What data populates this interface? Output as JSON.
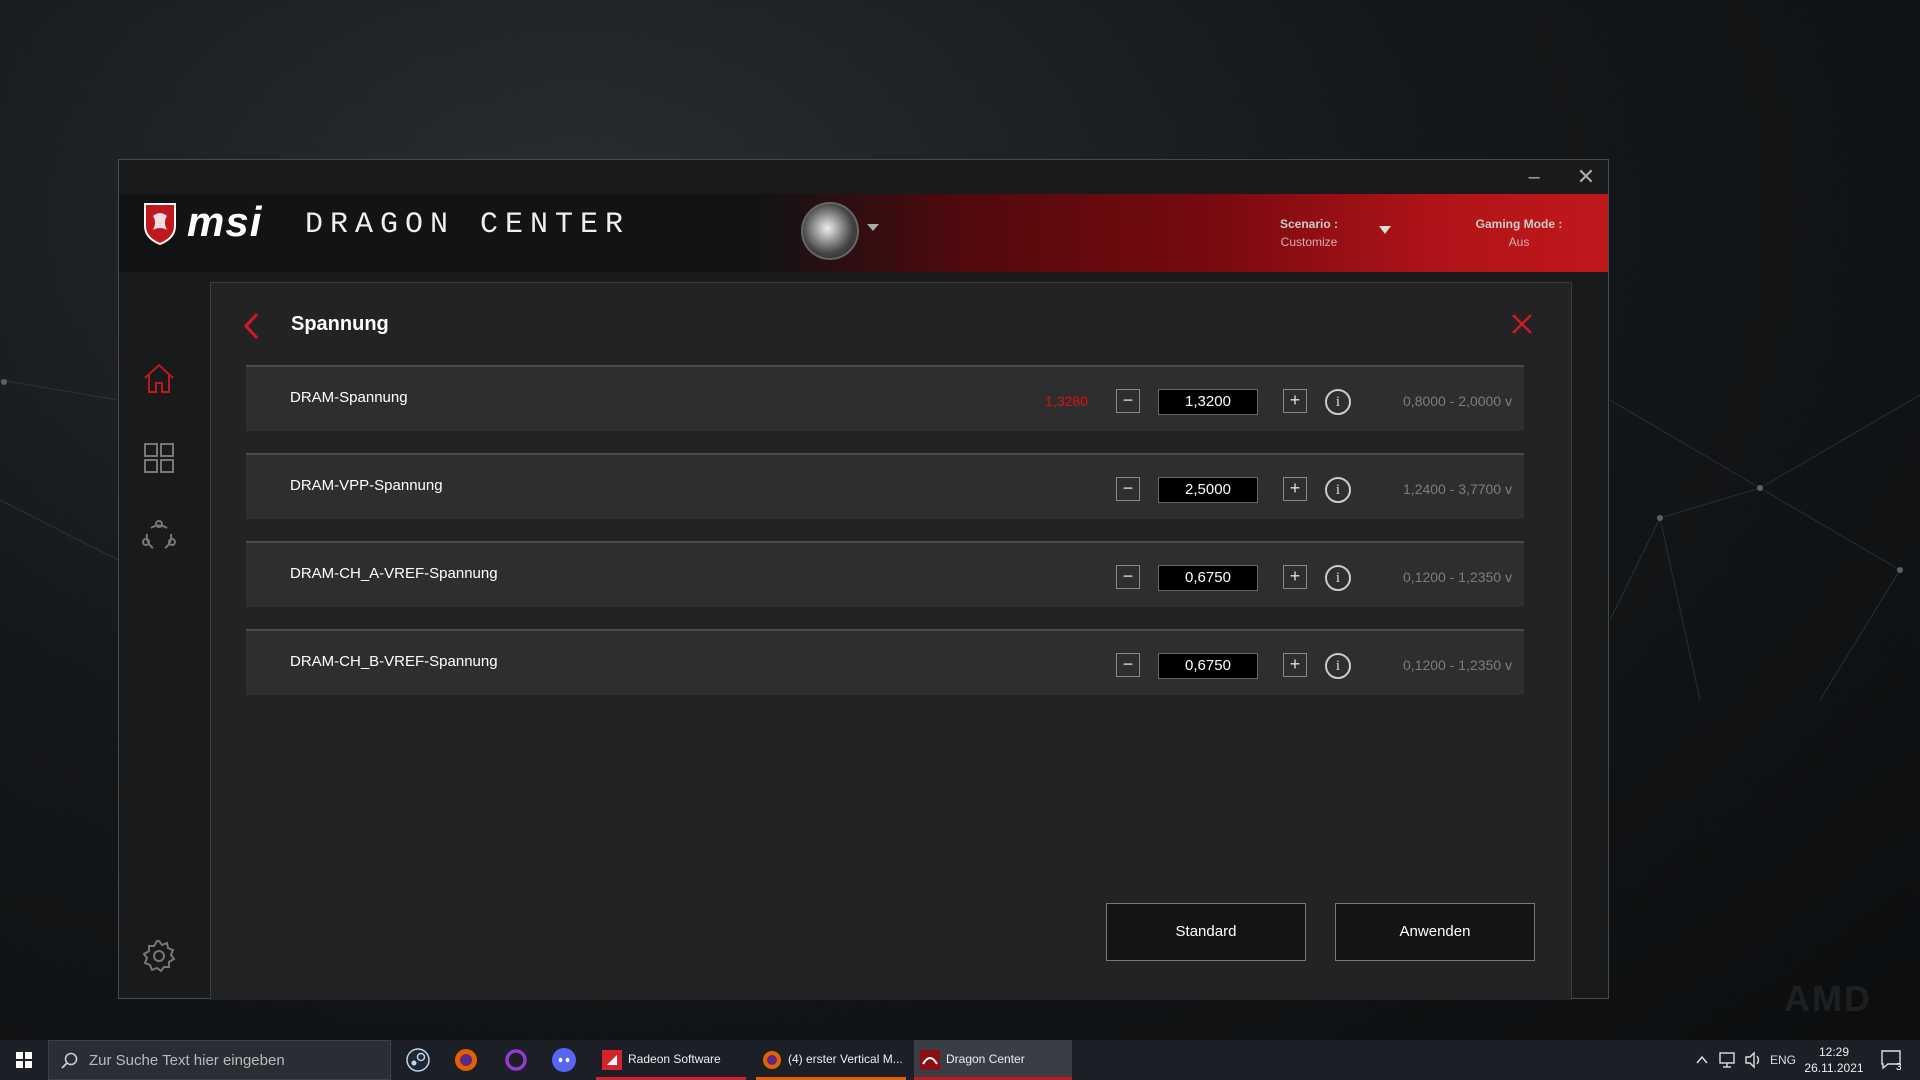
{
  "app": {
    "brand": "msi",
    "product": "DRAGON CENTER",
    "window_controls": {
      "minimize": "–",
      "close": "✕"
    }
  },
  "header": {
    "scenario": {
      "label": "Scenario :",
      "value": "Customize"
    },
    "gaming_mode": {
      "label": "Gaming Mode :",
      "value": "Aus"
    }
  },
  "sidebar": {
    "items": [
      {
        "icon": "home-icon"
      },
      {
        "icon": "apps-grid-icon"
      },
      {
        "icon": "connect-icon"
      },
      {
        "icon": "settings-gear-icon"
      }
    ]
  },
  "panel": {
    "title": "Spannung",
    "rows": [
      {
        "label": "DRAM-Spannung",
        "current": "1,3280",
        "value": "1,3200",
        "range": "0,8000 - 2,0000 v"
      },
      {
        "label": "DRAM-VPP-Spannung",
        "current": "",
        "value": "2,5000",
        "range": "1,2400 - 3,7700 v"
      },
      {
        "label": "DRAM-CH_A-VREF-Spannung",
        "current": "",
        "value": "0,6750",
        "range": "0,1200 - 1,2350 v"
      },
      {
        "label": "DRAM-CH_B-VREF-Spannung",
        "current": "",
        "value": "0,6750",
        "range": "0,1200 - 1,2350 v"
      }
    ],
    "minus_glyph": "−",
    "plus_glyph": "+",
    "info_glyph": "i",
    "buttons": {
      "standard": "Standard",
      "apply": "Anwenden"
    }
  },
  "taskbar": {
    "search_placeholder": "Zur Suche Text hier eingeben",
    "apps": [
      {
        "label": "Radeon Software",
        "accent": "#d1242f"
      },
      {
        "label": "(4) erster Vertical M...",
        "accent": "#e66000"
      },
      {
        "label": "Dragon Center",
        "accent": "#c0181c"
      }
    ],
    "tray": {
      "language": "ENG",
      "time": "12:29",
      "date": "26.11.2021",
      "notifications": "3"
    }
  },
  "colors": {
    "accent_red": "#c0181c",
    "panel_bg": "#232325",
    "row_bg": "#2e2e30"
  }
}
